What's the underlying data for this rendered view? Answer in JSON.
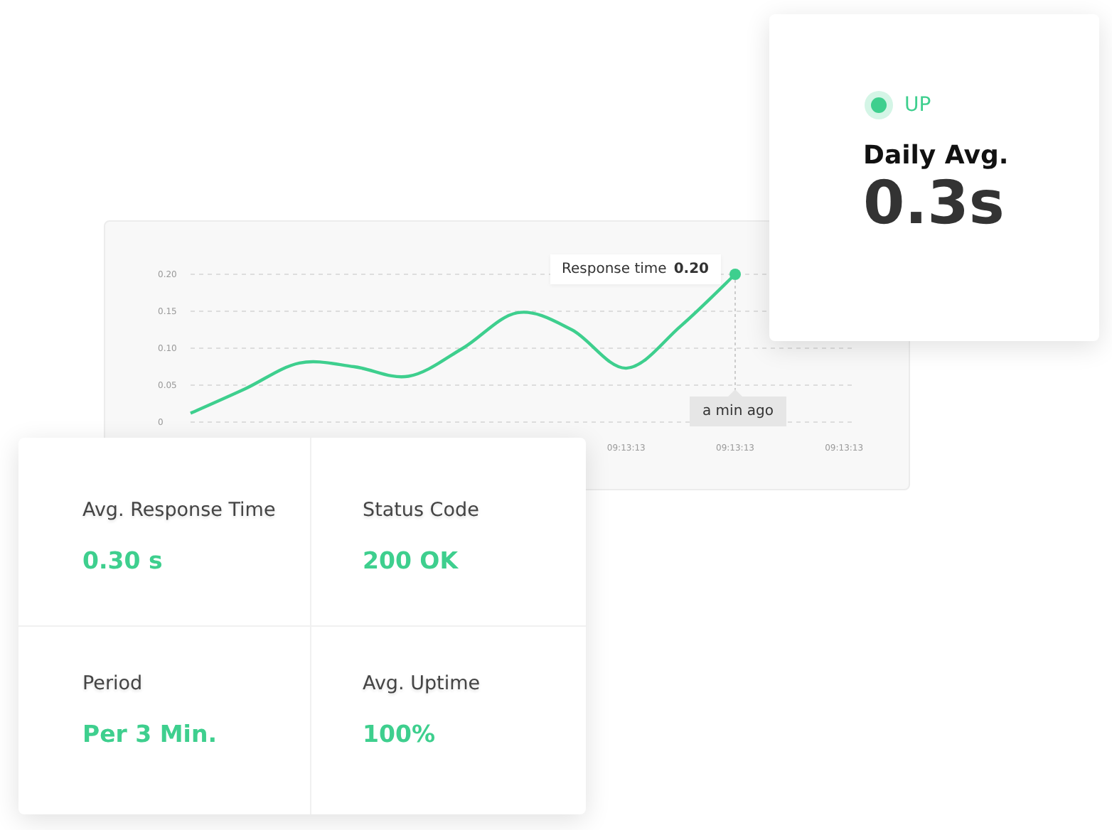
{
  "chart_panel": {
    "chart_data": {
      "type": "line",
      "categories": [
        null,
        null,
        null,
        null,
        null,
        null,
        null,
        null,
        "09:13:13",
        null,
        "09:13:13",
        null,
        "09:13:13"
      ],
      "series": [
        {
          "name": "Response time",
          "color": "#3ecf8e",
          "values": [
            0.012,
            0.045,
            0.08,
            0.075,
            0.062,
            0.1,
            0.148,
            0.125,
            0.073,
            0.13,
            0.2,
            null,
            null
          ]
        }
      ],
      "ylim": [
        0,
        0.2
      ],
      "grid": true,
      "yticks": [
        {
          "value": 0,
          "label": "0"
        },
        {
          "value": 0.05,
          "label": "0.05"
        },
        {
          "value": 0.1,
          "label": "0.10"
        },
        {
          "value": 0.15,
          "label": "0.15"
        },
        {
          "value": 0.2,
          "label": "0.20"
        }
      ]
    },
    "tooltip": {
      "value": "0.20"
    },
    "time_label": "a min ago"
  },
  "status_card": {
    "status": "UP",
    "title": "Daily Avg.",
    "value": "0.3s"
  },
  "metrics": [
    {
      "label": "Avg. Response Time",
      "value": "0.30 s"
    },
    {
      "label": "Status Code",
      "value": "200 OK"
    },
    {
      "label": "Period",
      "value": "Per 3 Min."
    },
    {
      "label": "Avg. Uptime",
      "value": "100%"
    }
  ]
}
